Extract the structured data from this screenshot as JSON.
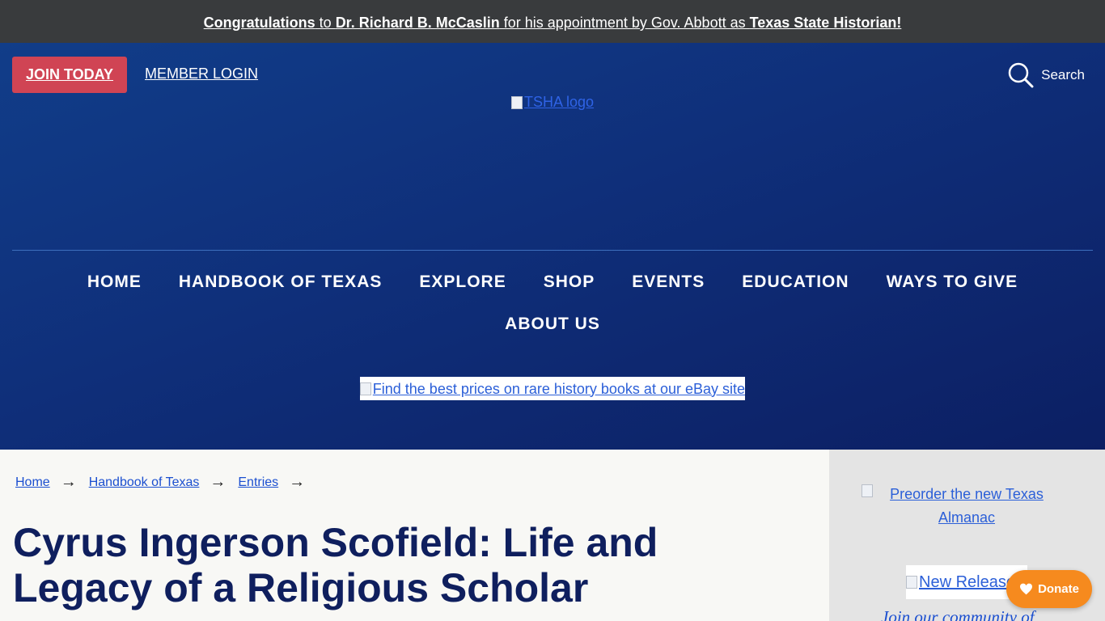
{
  "announcement": {
    "part1": "Congratulations",
    "part2": " to ",
    "part3": "Dr. Richard B. McCaslin",
    "part4": " for his appointment by Gov. Abbott as ",
    "part5": "Texas State Historian!"
  },
  "header": {
    "join_label": "JOIN TODAY",
    "member_login_label": "MEMBER LOGIN",
    "search_label": "Search",
    "logo_alt": "TSHA logo"
  },
  "nav": {
    "row1": [
      "HOME",
      "HANDBOOK OF TEXAS",
      "EXPLORE",
      "SHOP",
      "EVENTS",
      "EDUCATION",
      "WAYS TO GIVE"
    ],
    "row2": [
      "ABOUT US"
    ]
  },
  "ebay_banner": "Find the best prices on rare history books at our eBay site",
  "breadcrumb": [
    "Home",
    "Handbook of Texas",
    "Entries"
  ],
  "page_title": "Cyrus Ingerson Scofield: Life and Legacy of a Religious Scholar",
  "sidebar": {
    "preorder_text": "Preorder the new Texas Almanac",
    "new_release_text": "New Release",
    "join_community_text": "Join our community of"
  },
  "donate_label": "Donate",
  "colors": {
    "announcement_bg": "#393b3d",
    "header_bg": "#0f2f7a",
    "join_button": "#d04454",
    "title": "#0f1f5e",
    "donate": "#f68a1e",
    "sidebar_bg": "#e4e4e4"
  }
}
